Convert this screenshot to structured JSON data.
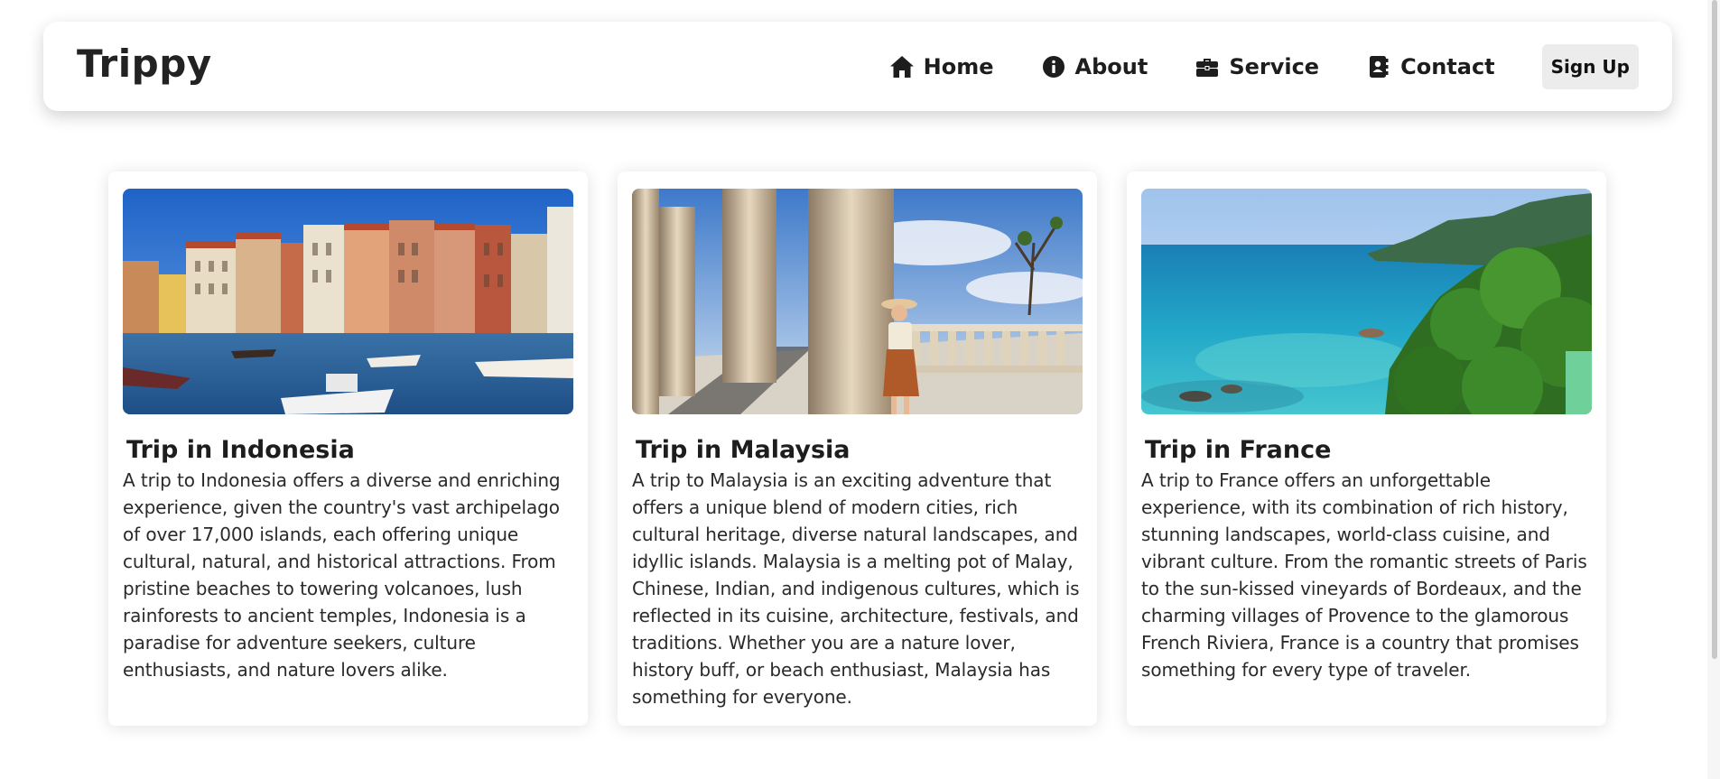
{
  "navbar": {
    "logo": "Trippy",
    "links": [
      {
        "label": "Home",
        "icon": "home-icon"
      },
      {
        "label": "About",
        "icon": "info-circle-icon"
      },
      {
        "label": "Service",
        "icon": "briefcase-icon"
      },
      {
        "label": "Contact",
        "icon": "contact-book-icon"
      }
    ],
    "signup_label": "Sign Up"
  },
  "cards": [
    {
      "image": "venice-canal-photo",
      "title": "Trip in Indonesia",
      "text": "A trip to Indonesia offers a diverse and enriching experience, given the country's vast archipelago of over 17,000 islands, each offering unique cultural, natural, and historical attractions. From pristine beaches to towering volcanoes, lush rainforests to ancient temples, Indonesia is a paradise for adventure seekers, culture enthusiasts, and nature lovers alike."
    },
    {
      "image": "woman-at-columns-photo",
      "title": "Trip in Malaysia",
      "text": "A trip to Malaysia is an exciting adventure that offers a unique blend of modern cities, rich cultural heritage, diverse natural landscapes, and idyllic islands. Malaysia is a melting pot of Malay, Chinese, Indian, and indigenous cultures, which is reflected in its cuisine, architecture, festivals, and traditions. Whether you are a nature lover, history buff, or beach enthusiast, Malaysia has something for everyone."
    },
    {
      "image": "tropical-coast-photo",
      "title": "Trip in France",
      "text": "A trip to France offers an unforgettable experience, with its combination of rich history, stunning landscapes, world-class cuisine, and vibrant culture. From the romantic streets of Paris to the sun-kissed vineyards of Bordeaux, and the charming villages of Provence to the glamorous French Riviera, France is a country that promises something for every type of traveler."
    }
  ]
}
